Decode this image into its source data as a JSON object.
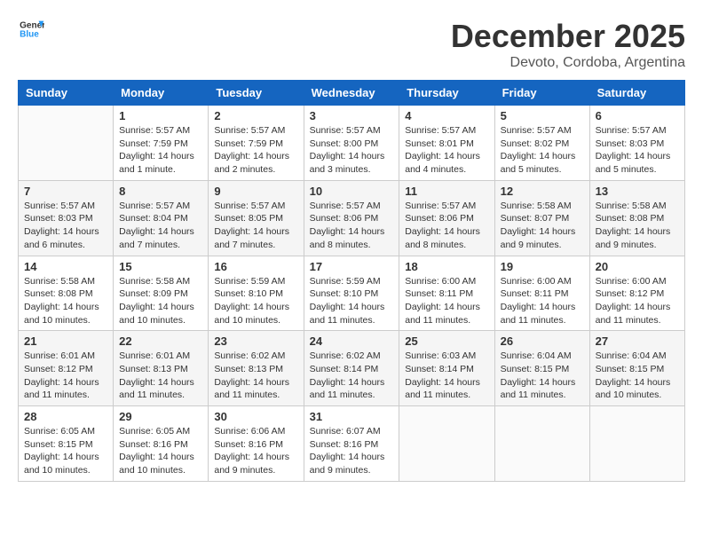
{
  "header": {
    "logo_general": "General",
    "logo_blue": "Blue",
    "month_year": "December 2025",
    "location": "Devoto, Cordoba, Argentina"
  },
  "days_of_week": [
    "Sunday",
    "Monday",
    "Tuesday",
    "Wednesday",
    "Thursday",
    "Friday",
    "Saturday"
  ],
  "weeks": [
    [
      {
        "day": "",
        "info": ""
      },
      {
        "day": "1",
        "info": "Sunrise: 5:57 AM\nSunset: 7:59 PM\nDaylight: 14 hours\nand 1 minute."
      },
      {
        "day": "2",
        "info": "Sunrise: 5:57 AM\nSunset: 7:59 PM\nDaylight: 14 hours\nand 2 minutes."
      },
      {
        "day": "3",
        "info": "Sunrise: 5:57 AM\nSunset: 8:00 PM\nDaylight: 14 hours\nand 3 minutes."
      },
      {
        "day": "4",
        "info": "Sunrise: 5:57 AM\nSunset: 8:01 PM\nDaylight: 14 hours\nand 4 minutes."
      },
      {
        "day": "5",
        "info": "Sunrise: 5:57 AM\nSunset: 8:02 PM\nDaylight: 14 hours\nand 5 minutes."
      },
      {
        "day": "6",
        "info": "Sunrise: 5:57 AM\nSunset: 8:03 PM\nDaylight: 14 hours\nand 5 minutes."
      }
    ],
    [
      {
        "day": "7",
        "info": "Sunrise: 5:57 AM\nSunset: 8:03 PM\nDaylight: 14 hours\nand 6 minutes."
      },
      {
        "day": "8",
        "info": "Sunrise: 5:57 AM\nSunset: 8:04 PM\nDaylight: 14 hours\nand 7 minutes."
      },
      {
        "day": "9",
        "info": "Sunrise: 5:57 AM\nSunset: 8:05 PM\nDaylight: 14 hours\nand 7 minutes."
      },
      {
        "day": "10",
        "info": "Sunrise: 5:57 AM\nSunset: 8:06 PM\nDaylight: 14 hours\nand 8 minutes."
      },
      {
        "day": "11",
        "info": "Sunrise: 5:57 AM\nSunset: 8:06 PM\nDaylight: 14 hours\nand 8 minutes."
      },
      {
        "day": "12",
        "info": "Sunrise: 5:58 AM\nSunset: 8:07 PM\nDaylight: 14 hours\nand 9 minutes."
      },
      {
        "day": "13",
        "info": "Sunrise: 5:58 AM\nSunset: 8:08 PM\nDaylight: 14 hours\nand 9 minutes."
      }
    ],
    [
      {
        "day": "14",
        "info": "Sunrise: 5:58 AM\nSunset: 8:08 PM\nDaylight: 14 hours\nand 10 minutes."
      },
      {
        "day": "15",
        "info": "Sunrise: 5:58 AM\nSunset: 8:09 PM\nDaylight: 14 hours\nand 10 minutes."
      },
      {
        "day": "16",
        "info": "Sunrise: 5:59 AM\nSunset: 8:10 PM\nDaylight: 14 hours\nand 10 minutes."
      },
      {
        "day": "17",
        "info": "Sunrise: 5:59 AM\nSunset: 8:10 PM\nDaylight: 14 hours\nand 11 minutes."
      },
      {
        "day": "18",
        "info": "Sunrise: 6:00 AM\nSunset: 8:11 PM\nDaylight: 14 hours\nand 11 minutes."
      },
      {
        "day": "19",
        "info": "Sunrise: 6:00 AM\nSunset: 8:11 PM\nDaylight: 14 hours\nand 11 minutes."
      },
      {
        "day": "20",
        "info": "Sunrise: 6:00 AM\nSunset: 8:12 PM\nDaylight: 14 hours\nand 11 minutes."
      }
    ],
    [
      {
        "day": "21",
        "info": "Sunrise: 6:01 AM\nSunset: 8:12 PM\nDaylight: 14 hours\nand 11 minutes."
      },
      {
        "day": "22",
        "info": "Sunrise: 6:01 AM\nSunset: 8:13 PM\nDaylight: 14 hours\nand 11 minutes."
      },
      {
        "day": "23",
        "info": "Sunrise: 6:02 AM\nSunset: 8:13 PM\nDaylight: 14 hours\nand 11 minutes."
      },
      {
        "day": "24",
        "info": "Sunrise: 6:02 AM\nSunset: 8:14 PM\nDaylight: 14 hours\nand 11 minutes."
      },
      {
        "day": "25",
        "info": "Sunrise: 6:03 AM\nSunset: 8:14 PM\nDaylight: 14 hours\nand 11 minutes."
      },
      {
        "day": "26",
        "info": "Sunrise: 6:04 AM\nSunset: 8:15 PM\nDaylight: 14 hours\nand 11 minutes."
      },
      {
        "day": "27",
        "info": "Sunrise: 6:04 AM\nSunset: 8:15 PM\nDaylight: 14 hours\nand 10 minutes."
      }
    ],
    [
      {
        "day": "28",
        "info": "Sunrise: 6:05 AM\nSunset: 8:15 PM\nDaylight: 14 hours\nand 10 minutes."
      },
      {
        "day": "29",
        "info": "Sunrise: 6:05 AM\nSunset: 8:16 PM\nDaylight: 14 hours\nand 10 minutes."
      },
      {
        "day": "30",
        "info": "Sunrise: 6:06 AM\nSunset: 8:16 PM\nDaylight: 14 hours\nand 9 minutes."
      },
      {
        "day": "31",
        "info": "Sunrise: 6:07 AM\nSunset: 8:16 PM\nDaylight: 14 hours\nand 9 minutes."
      },
      {
        "day": "",
        "info": ""
      },
      {
        "day": "",
        "info": ""
      },
      {
        "day": "",
        "info": ""
      }
    ]
  ]
}
